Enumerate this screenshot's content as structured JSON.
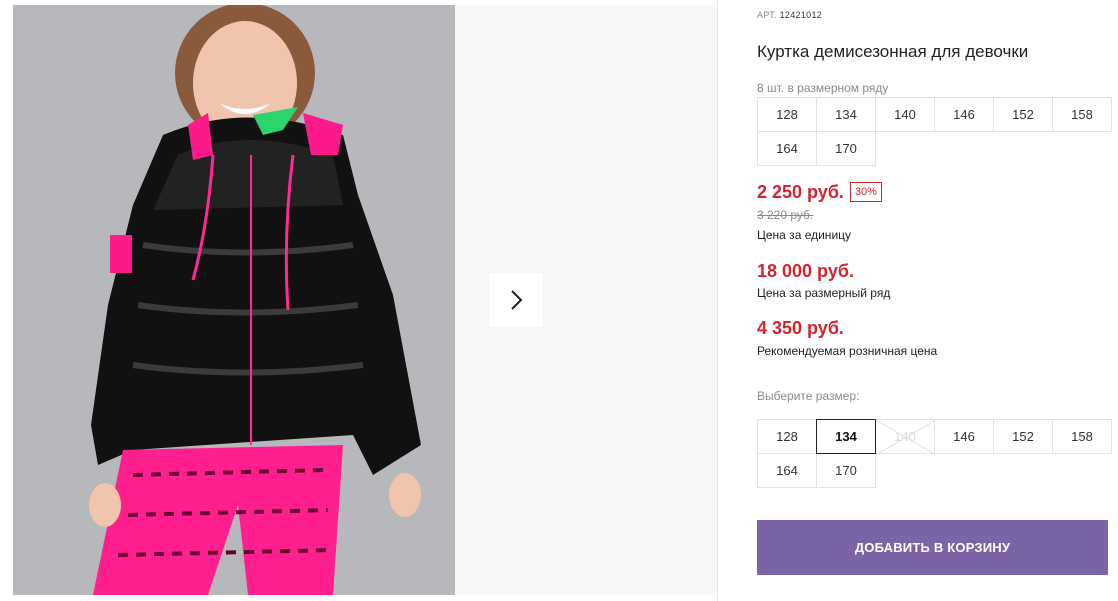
{
  "product": {
    "art_label": "АРТ.",
    "art_number": "12421012",
    "title": "Куртка демисезонная для девочки"
  },
  "size_row": {
    "note": "8 шт. в размерном ряду",
    "sizes": [
      "128",
      "134",
      "140",
      "146",
      "152",
      "158",
      "164",
      "170"
    ]
  },
  "prices": {
    "current": "2 250 руб.",
    "discount_badge": "30%",
    "old": "3 220 руб.",
    "unit_caption": "Цена за единицу",
    "row_total": "18 000 руб.",
    "row_caption": "Цена за размерный ряд",
    "retail": "4 350 руб.",
    "retail_caption": "Рекомендуемая розничная цена"
  },
  "size_select": {
    "label": "Выберите размер:",
    "sizes": [
      "128",
      "134",
      "140",
      "146",
      "152",
      "158",
      "164",
      "170"
    ],
    "selected": "134",
    "unavailable": [
      "140"
    ]
  },
  "cart": {
    "add_label": "ДОБАВИТЬ В КОРЗИНУ"
  },
  "colors": {
    "price_red": "#d4232f",
    "button_purple": "#7c64a6"
  },
  "icons": {
    "next": "chevron-right-icon"
  }
}
